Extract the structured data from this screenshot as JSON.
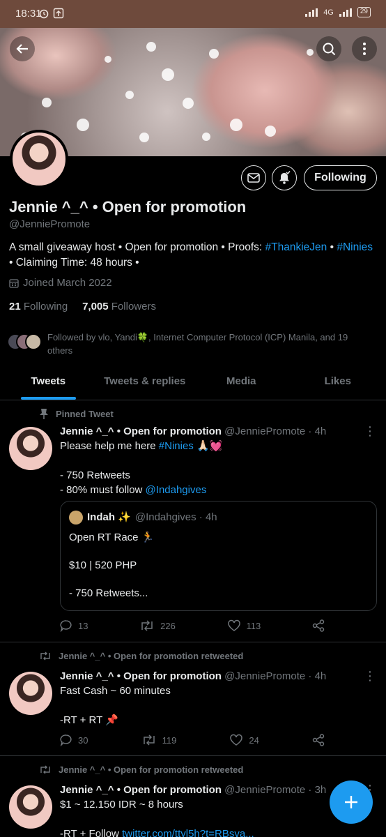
{
  "status_bar": {
    "time": "18:31",
    "network": "4G",
    "battery": "29"
  },
  "profile": {
    "name": "Jennie ^_^ • Open for promotion",
    "handle": "@JenniePromote",
    "bio_parts": [
      "A small giveaway host • Open for promotion • Proofs: ",
      "#ThankieJen",
      " • ",
      "#Ninies",
      " • Claiming Time: 48 hours •"
    ],
    "joined": "Joined March 2022",
    "following_count": "21",
    "following_label": "Following",
    "followers_count": "7,005",
    "followers_label": "Followers",
    "followed_by": "Followed by vlo, Yandi🍀, Internet Computer Protocol (ICP) Manila, and 19 others",
    "follow_button": "Following"
  },
  "tabs": [
    "Tweets",
    "Tweets & replies",
    "Media",
    "Likes"
  ],
  "tweets": [
    {
      "context": "Pinned Tweet",
      "name": "Jennie ^_^ • Open for promotion",
      "meta": "@JenniePromote · 4h",
      "line1_parts": [
        "Please help me here ",
        "#Ninies",
        " 🙏🏻💓"
      ],
      "line2": "- 750 Retweets",
      "line3_parts": [
        "- 80% must follow ",
        "@Indahgives"
      ],
      "quote": {
        "name": "Indah ✨",
        "meta": "@Indahgives · 4h",
        "line1": "Open RT Race 🏃",
        "line2": "$10 | 520 PHP",
        "line3": "- 750 Retweets..."
      },
      "replies": "13",
      "retweets": "226",
      "likes": "113"
    },
    {
      "context": "Jennie ^_^ • Open for promotion retweeted",
      "name": "Jennie ^_^ • Open for promotion",
      "meta": "@JenniePromote · 4h",
      "line1": "Fast Cash ~ 60 minutes",
      "line2": "-RT + RT 📌",
      "replies": "30",
      "retweets": "119",
      "likes": "24"
    },
    {
      "context": "Jennie ^_^ • Open for promotion retweeted",
      "name": "Jennie ^_^ • Open for promotion",
      "meta": "@JenniePromote · 3h",
      "line1": "$1 ~ 12.150 IDR ~ 8 hours",
      "line2_parts": [
        "-RT + Follow ",
        "twitter.com/ttyl5h?t=RBsva..."
      ]
    }
  ],
  "colors": {
    "accent": "#1d9bf0",
    "muted": "#71767b",
    "text": "#e7e9ea",
    "background": "#000000"
  }
}
